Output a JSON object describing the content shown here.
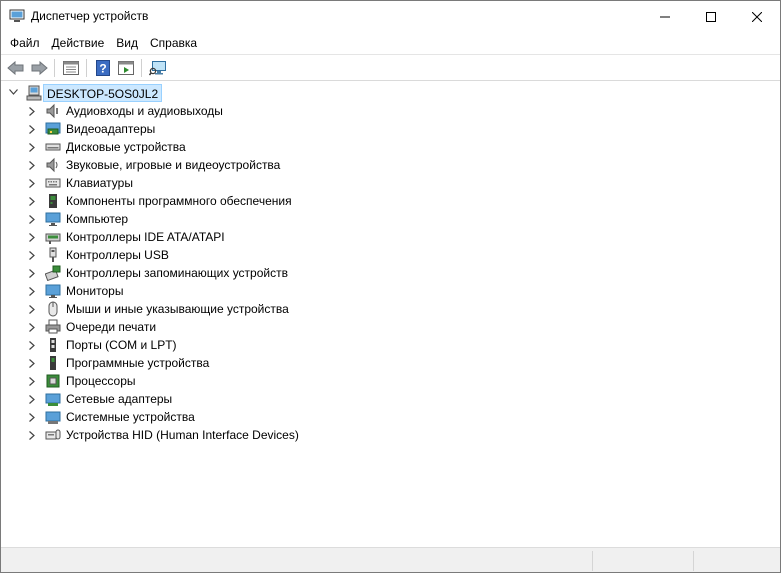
{
  "window": {
    "title": "Диспетчер устройств"
  },
  "menu": [
    {
      "label": "Файл"
    },
    {
      "label": "Действие"
    },
    {
      "label": "Вид"
    },
    {
      "label": "Справка"
    }
  ],
  "toolbar": {
    "buttons": [
      "back-icon",
      "forward-icon",
      "properties-pane-icon",
      "help-icon",
      "update-driver-icon",
      "scan-hardware-icon"
    ]
  },
  "tree": {
    "root": {
      "label": "DESKTOP-5OS0JL2",
      "expanded": true,
      "selected": true
    },
    "items": [
      {
        "label": "Аудиовходы и аудиовыходы",
        "icon": "audio-io-icon"
      },
      {
        "label": "Видеоадаптеры",
        "icon": "display-adapter-icon"
      },
      {
        "label": "Дисковые устройства",
        "icon": "disk-drive-icon"
      },
      {
        "label": "Звуковые, игровые и видеоустройства",
        "icon": "sound-icon"
      },
      {
        "label": "Клавиатуры",
        "icon": "keyboard-icon"
      },
      {
        "label": "Компоненты программного обеспечения",
        "icon": "software-component-icon"
      },
      {
        "label": "Компьютер",
        "icon": "computer-icon"
      },
      {
        "label": "Контроллеры IDE ATA/ATAPI",
        "icon": "ide-controller-icon"
      },
      {
        "label": "Контроллеры USB",
        "icon": "usb-icon"
      },
      {
        "label": "Контроллеры запоминающих устройств",
        "icon": "storage-controller-icon"
      },
      {
        "label": "Мониторы",
        "icon": "monitor-icon"
      },
      {
        "label": "Мыши и иные указывающие устройства",
        "icon": "mouse-icon"
      },
      {
        "label": "Очереди печати",
        "icon": "printer-icon"
      },
      {
        "label": "Порты (COM и LPT)",
        "icon": "port-icon"
      },
      {
        "label": "Программные устройства",
        "icon": "software-device-icon"
      },
      {
        "label": "Процессоры",
        "icon": "processor-icon"
      },
      {
        "label": "Сетевые адаптеры",
        "icon": "network-adapter-icon"
      },
      {
        "label": "Системные устройства",
        "icon": "system-device-icon"
      },
      {
        "label": "Устройства HID (Human Interface Devices)",
        "icon": "hid-icon"
      }
    ]
  },
  "colors": {
    "selection_bg": "#cce8ff",
    "selection_border": "#99d1ff"
  }
}
